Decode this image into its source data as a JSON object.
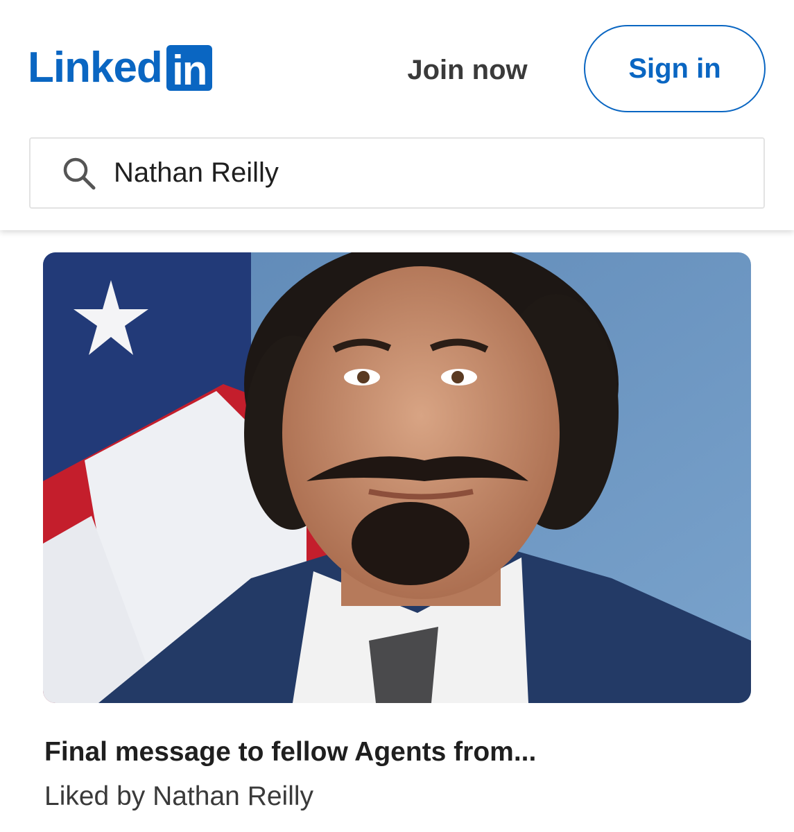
{
  "header": {
    "logo": {
      "word": "Linked",
      "box": "in"
    },
    "join_label": "Join now",
    "signin_label": "Sign in"
  },
  "search": {
    "icon": "search-icon",
    "value": "Nathan Reilly"
  },
  "post": {
    "title": "Final message to fellow Agents from...",
    "liked_by": "Liked by Nathan Reilly"
  },
  "colors": {
    "brand": "#0a66c2",
    "text_dark": "#1f1f1f",
    "text_muted": "#3a3a3a"
  }
}
